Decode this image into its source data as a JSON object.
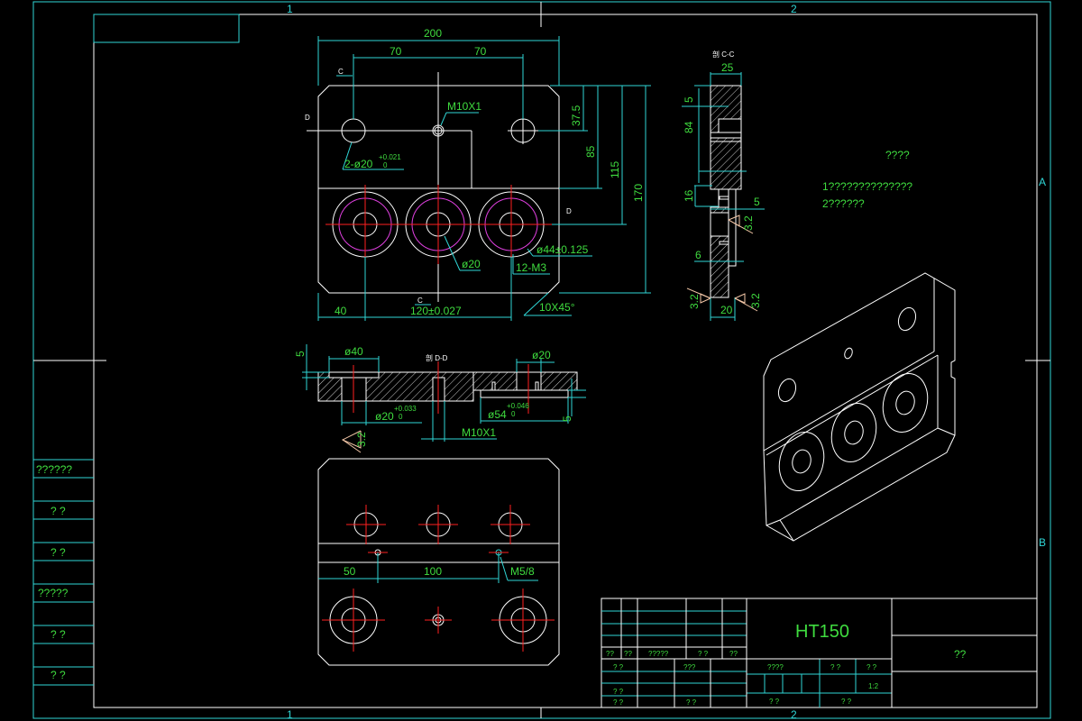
{
  "frame": {
    "zones_top": [
      "1",
      "2"
    ],
    "zones_bottom": [
      "1",
      "2"
    ],
    "zones_right": [
      "A",
      "B"
    ],
    "colors": {
      "outline": "#ffffff",
      "dimension": "#2fd6d6",
      "text": "#3fdc3f",
      "centerline": "#ff2020",
      "thread": "#e040e0"
    }
  },
  "left_strip": [
    "??????",
    "? ?",
    "? ?",
    "?????",
    "? ?",
    "? ?"
  ],
  "front_view": {
    "dims": {
      "overall_width": "200",
      "spacing_left": "70",
      "spacing_right": "70",
      "d37": "37.5",
      "d85": "85",
      "d115": "115",
      "d170": "170",
      "d40": "40",
      "d120": "120±0.027"
    },
    "labels": {
      "m10": "M10X1",
      "holes": "2-ø20",
      "holes_tol_upper": "+0.021",
      "holes_tol_lower": "0",
      "bore": "ø20",
      "pcd": "ø44±0.125",
      "threads": "12-M3",
      "chamfer": "10X45°"
    },
    "section_marks": [
      "C",
      "C",
      "D",
      "D"
    ]
  },
  "section_dd": {
    "title": "剖 D-D",
    "dims": {
      "d5_top": "5",
      "d40": "ø40",
      "d20_right": "ø20",
      "d20": "ø20",
      "d20_tol_upper": "+0.033",
      "d20_tol_lower": "0",
      "d54": "ø54",
      "d54_tol_upper": "+0.046",
      "d54_tol_lower": "0",
      "m10": "M10X1",
      "d5_right": "5"
    },
    "roughness": "3.2"
  },
  "section_cc": {
    "title": "剖 C-C",
    "dims": {
      "d25": "25",
      "d5": "5",
      "d84": "84",
      "d16": "16",
      "d5b": "5",
      "d6": "6",
      "d20": "20"
    },
    "roughness": [
      "3.2",
      "3.2",
      "3.2"
    ]
  },
  "bottom_view": {
    "dims": {
      "d50": "50",
      "d100": "100"
    },
    "label": "M5/8"
  },
  "notes": {
    "title": "????",
    "lines": [
      "1??????????????",
      "2??????"
    ]
  },
  "title_block": {
    "material": "HT150",
    "name": "??",
    "upper_row": [
      "??",
      "??",
      "?????",
      "? ?",
      "??"
    ],
    "lower_left": [
      "? ?",
      "???",
      "? ?",
      "? ?",
      "? ?"
    ],
    "middle": [
      "????",
      "? ?",
      "? ?"
    ],
    "scale": "1:2",
    "bottom": [
      "?   ?",
      "?   ?"
    ]
  }
}
